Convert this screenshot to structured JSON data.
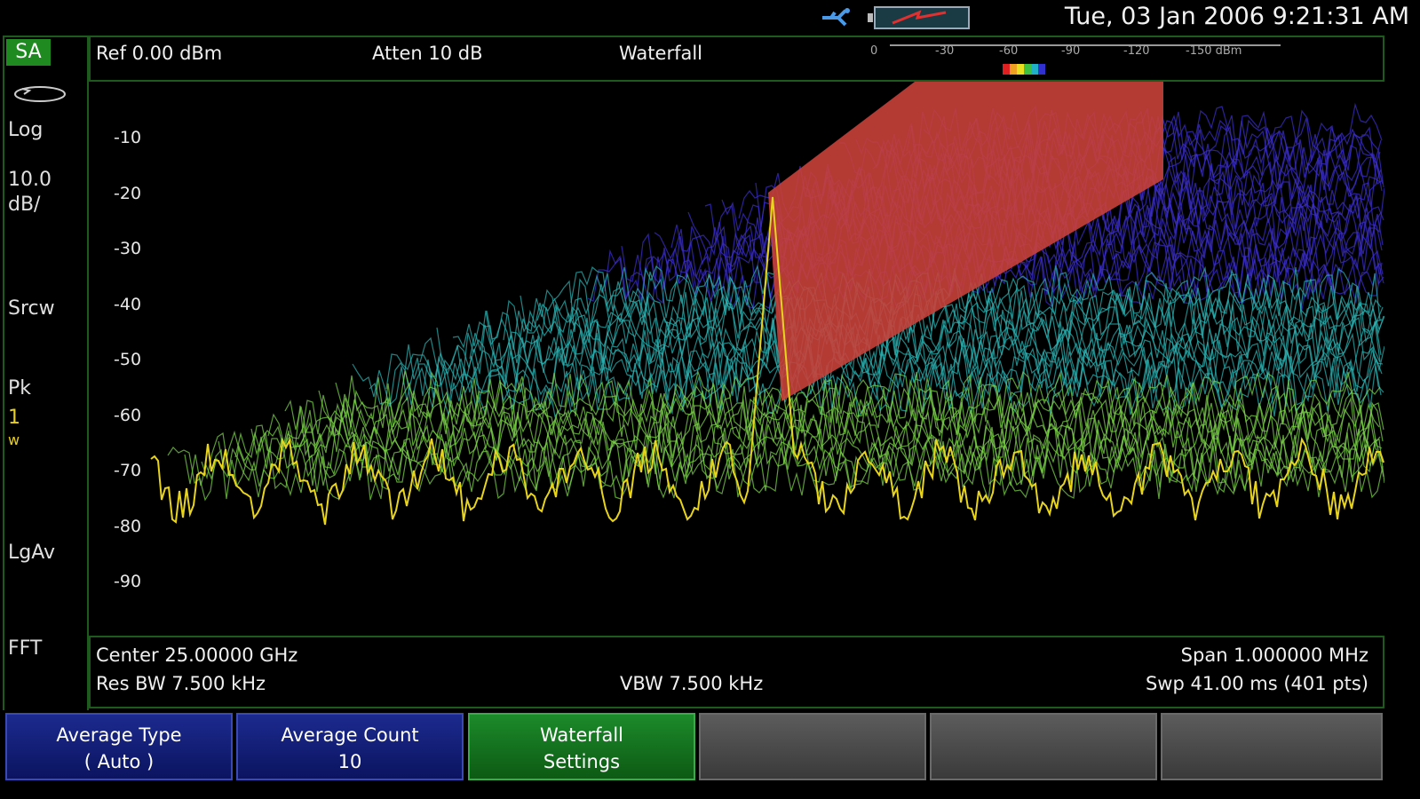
{
  "status_bar": {
    "datetime": "Tue, 03 Jan 2006 9:21:31 AM",
    "icons": [
      "usb-icon",
      "battery-icon"
    ]
  },
  "left_panel": {
    "mode": "SA",
    "items": [
      "Log",
      "10.0",
      "dB/",
      "Srcw",
      "Pk",
      "1",
      "w",
      "LgAv",
      "FFT"
    ],
    "trigger_icon": "trigger-icon"
  },
  "header": {
    "ref": "Ref 0.00 dBm",
    "atten": "Atten 10 dB",
    "view": "Waterfall",
    "scale_labels": [
      "0",
      "-30",
      "-60",
      "-90",
      "-120",
      "-150 dBm"
    ]
  },
  "graticule": {
    "y_labels": [
      "-10",
      "-20",
      "-30",
      "-40",
      "-50",
      "-60",
      "-70",
      "-80",
      "-90"
    ],
    "colors": {
      "trace": "#e8d41a",
      "waterfall_low": "#3b2ec8",
      "waterfall_mid": "#2bb0b0",
      "waterfall_high": "#7ad048",
      "peak_wall": "#c8403a"
    }
  },
  "footer": {
    "center": "Center 25.00000 GHz",
    "span": "Span 1.000000 MHz",
    "res_bw": "Res BW 7.500 kHz",
    "vbw": "VBW 7.500 kHz",
    "sweep": "Swp 41.00 ms (401 pts)"
  },
  "softkeys": [
    {
      "line1": "Average Type",
      "line2": "( Auto )"
    },
    {
      "line1": "Average Count",
      "line2": "10"
    },
    {
      "line1": "Waterfall",
      "line2": "Settings"
    },
    {
      "line1": "",
      "line2": ""
    },
    {
      "line1": "",
      "line2": ""
    },
    {
      "line1": "",
      "line2": ""
    }
  ]
}
